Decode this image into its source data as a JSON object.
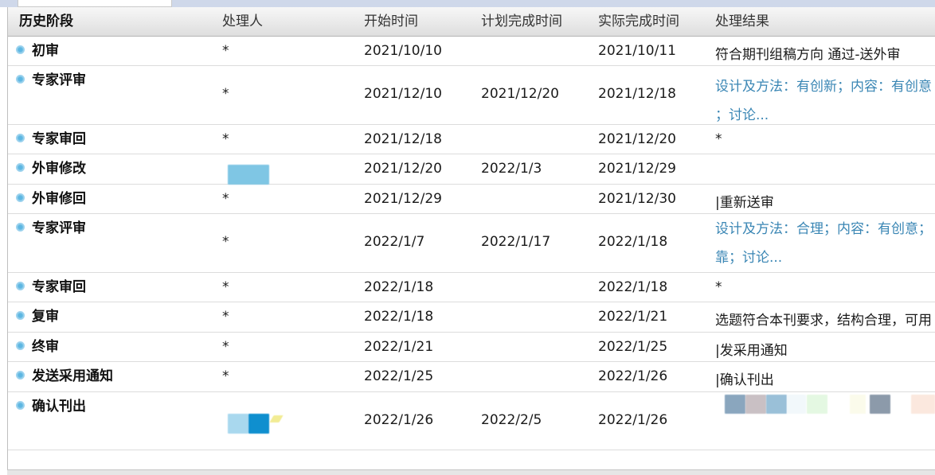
{
  "table": {
    "headers": [
      "历史阶段",
      "处理人",
      "开始时间",
      "计划完成时间",
      "实际完成时间",
      "处理结果"
    ],
    "rows": [
      {
        "stage": "初审",
        "handler": "*",
        "start": "2021/10/10",
        "planned": "",
        "actual": "2021/10/11",
        "result": "符合期刊组稿方向 通过-送外审"
      },
      {
        "stage": "专家评审",
        "handler": "*",
        "start": "2021/12/10",
        "planned": "2021/12/20",
        "actual": "2021/12/18",
        "result_line1": "设计及方法：有创新；内容：有创意",
        "result_line2": "；讨论..."
      },
      {
        "stage": "专家审回",
        "handler": "*",
        "start": "2021/12/18",
        "planned": "",
        "actual": "2021/12/20",
        "result": "*"
      },
      {
        "stage": "外审修改",
        "handler": "",
        "start": "2021/12/20",
        "planned": "2022/1/3",
        "actual": "2021/12/29",
        "result": ""
      },
      {
        "stage": "外审修回",
        "handler": "*",
        "start": "2021/12/29",
        "planned": "",
        "actual": "2021/12/30",
        "result": "|重新送审"
      },
      {
        "stage": "专家评审",
        "handler": "*",
        "start": "2022/1/7",
        "planned": "2022/1/17",
        "actual": "2022/1/18",
        "result_line1": "设计及方法：合理；内容：有创意；",
        "result_line2": "靠；讨论..."
      },
      {
        "stage": "专家审回",
        "handler": "*",
        "start": "2022/1/18",
        "planned": "",
        "actual": "2022/1/18",
        "result": "*"
      },
      {
        "stage": "复审",
        "handler": "*",
        "start": "2022/1/18",
        "planned": "",
        "actual": "2022/1/21",
        "result": "选题符合本刊要求，结构合理，可用"
      },
      {
        "stage": "终审",
        "handler": "*",
        "start": "2022/1/21",
        "planned": "",
        "actual": "2022/1/25",
        "result": "|发采用通知"
      },
      {
        "stage": "发送采用通知",
        "handler": "*",
        "start": "2022/1/25",
        "planned": "",
        "actual": "2022/1/26",
        "result": "|确认刊出"
      },
      {
        "stage": "确认刊出",
        "handler": "",
        "start": "2022/1/26",
        "planned": "2022/2/5",
        "actual": "2022/1/26",
        "result": ""
      }
    ]
  },
  "colors": {
    "link": "#3a86b4",
    "bullet": "#5cb6e2",
    "header_bg": "#e4e4e4"
  },
  "icons": {
    "stage_bullet": "circle-bullet-icon"
  }
}
